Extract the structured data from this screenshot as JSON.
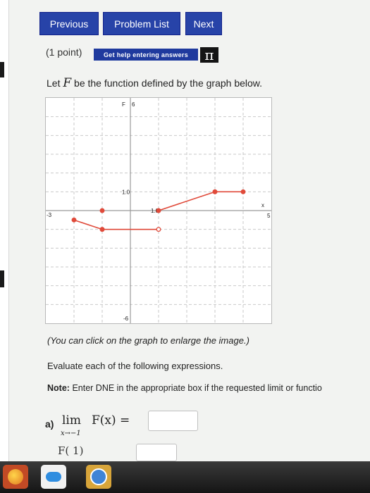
{
  "nav": {
    "previous": "Previous",
    "problem_list": "Problem List",
    "next": "Next"
  },
  "problem": {
    "points": "(1 point)",
    "help_button": "Get help entering answers",
    "pi_symbol": "π",
    "statement_prefix": "Let",
    "function_name": "F",
    "statement_suffix": "be the function defined by the graph below."
  },
  "graph": {
    "labels": {
      "y_axis": "F",
      "y_max": "6",
      "y_one": "1.0",
      "x_one": "1.0",
      "x_min": "-3",
      "x_axis": "x",
      "x_max": "5",
      "y_min": "-6"
    },
    "colors": {
      "curve": "#e04a3a",
      "grid": "#c9c9c9",
      "axis": "#9a9a9a"
    }
  },
  "chart_data": {
    "type": "line",
    "xlim": [
      -3,
      5
    ],
    "ylim": [
      -6,
      6
    ],
    "grid": true,
    "segments": [
      {
        "x": [
          -2,
          -1
        ],
        "y": [
          -0.5,
          -1
        ],
        "open_start": false,
        "open_end": true
      },
      {
        "x": [
          -1,
          1
        ],
        "y": [
          -1,
          -1
        ],
        "open_start": false,
        "open_end": true
      },
      {
        "x": [
          1,
          3
        ],
        "y": [
          0,
          1
        ],
        "open_start": false,
        "open_end": true
      },
      {
        "x": [
          3,
          4
        ],
        "y": [
          1,
          1
        ],
        "open_start": false,
        "open_end": false
      }
    ],
    "isolated_points": [
      {
        "x": -1,
        "y": 0
      }
    ]
  },
  "caption": "(You can click on the graph to enlarge the image.)",
  "instructions": "Evaluate each of the following expressions.",
  "note": {
    "label": "Note:",
    "text": "Enter DNE in the appropriate box if the requested limit or functio"
  },
  "part_a": {
    "label": "a)",
    "lim": "lim",
    "subscript": "x→−1",
    "expression": "F(x) ="
  },
  "part_b_partial": "F(  1)"
}
